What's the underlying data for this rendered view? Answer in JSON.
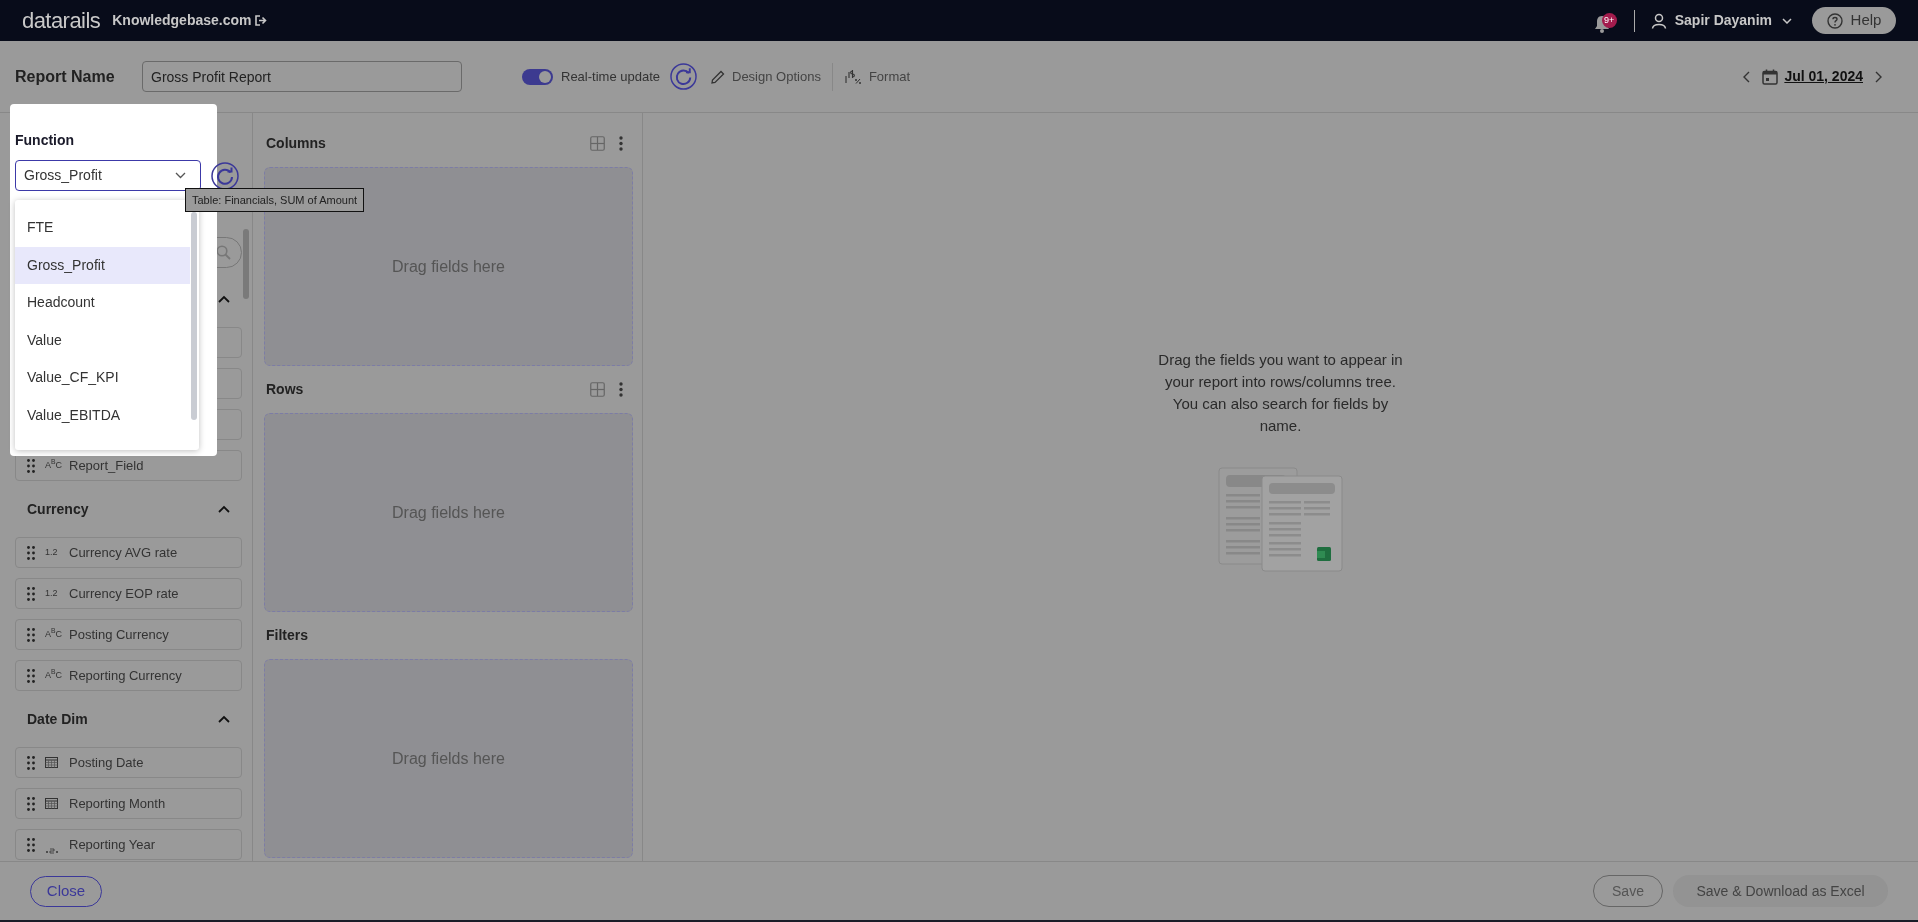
{
  "top_bar": {
    "logo": "datarails",
    "workspace": "Knowledgebase.com",
    "notifications": "9+",
    "user": "Sapir Dayanim",
    "help": "Help"
  },
  "header": {
    "report_name_label": "Report Name",
    "report_name": "Gross Profit Report",
    "realtime_update": {
      "label": "Real-time update",
      "on": true
    },
    "design_options": "Design Options",
    "format": "Format",
    "date": "Jul 01, 2024"
  },
  "function_popup": {
    "label": "Function",
    "value": "Gross_Profit",
    "tooltip": "Table: Financials, SUM of Amount",
    "options": [
      {
        "label": "FTE",
        "selected": false
      },
      {
        "label": "Gross_Profit",
        "selected": true
      },
      {
        "label": "Headcount",
        "selected": false
      },
      {
        "label": "Value",
        "selected": false
      },
      {
        "label": "Value_CF_KPI",
        "selected": false
      },
      {
        "label": "Value_EBITDA",
        "selected": false
      }
    ]
  },
  "field_sections": [
    {
      "expanded": true,
      "fields": [
        {
          "kind": "text",
          "label": "Report_Field",
          "type_mark": "A$^{B}$C"
        }
      ]
    },
    {
      "title": "Currency",
      "expanded": true,
      "fields": [
        {
          "kind": "number",
          "label": "Currency AVG rate",
          "type_mark": "1.2"
        },
        {
          "kind": "number",
          "label": "Currency EOP rate",
          "type_mark": "1.2"
        },
        {
          "kind": "text",
          "label": "Posting Currency",
          "type_mark": "A$^{B}$C"
        },
        {
          "kind": "text",
          "label": "Reporting Currency",
          "type_mark": "A$^{B}$C"
        }
      ]
    },
    {
      "title": "Date Dim",
      "expanded": true,
      "fields": [
        {
          "kind": "date",
          "label": "Posting Date"
        },
        {
          "kind": "date",
          "label": "Reporting Month"
        },
        {
          "kind": "year",
          "label": "Reporting Year"
        }
      ]
    }
  ],
  "drop_zones": [
    {
      "title": "Columns",
      "placeholder": "Drag fields here",
      "tools": true
    },
    {
      "title": "Rows",
      "placeholder": "Drag fields here",
      "tools": true
    },
    {
      "title": "Filters",
      "placeholder": "Drag fields here",
      "tools": false
    }
  ],
  "empty_state": "Drag the fields you want to appear in your report into rows/columns tree. You can also search for fields by name.",
  "footer": {
    "close": "Close",
    "save": "Save",
    "save_download": "Save & Download as Excel"
  }
}
